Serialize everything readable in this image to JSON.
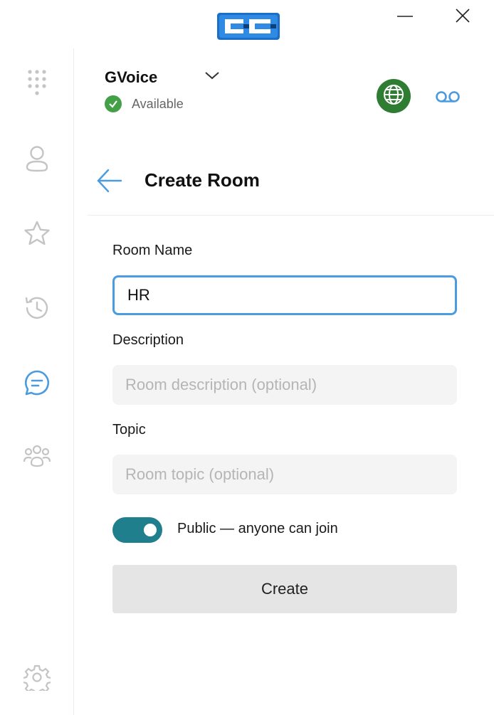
{
  "window": {
    "logo": "cc-logo",
    "minimize_icon": "minimize-icon",
    "close_icon": "close-icon"
  },
  "sidebar": {
    "items": [
      {
        "name": "dialpad",
        "icon": "dialpad-icon"
      },
      {
        "name": "contacts",
        "icon": "person-icon"
      },
      {
        "name": "favorites",
        "icon": "star-icon"
      },
      {
        "name": "history",
        "icon": "history-icon"
      },
      {
        "name": "chat",
        "icon": "chat-icon",
        "active": true
      },
      {
        "name": "groups",
        "icon": "group-icon"
      },
      {
        "name": "settings",
        "icon": "gear-icon"
      }
    ],
    "active_color": "#4a9be0",
    "inactive_color": "#c4c4c4"
  },
  "account": {
    "name": "GVoice",
    "status": "Available",
    "status_color": "#43a047"
  },
  "header_actions": {
    "globe_icon": "globe-icon",
    "globe_color": "#2e7d32",
    "voicemail_icon": "voicemail-icon"
  },
  "page": {
    "title": "Create Room",
    "back_icon": "back-arrow-icon"
  },
  "form": {
    "room_name_label": "Room Name",
    "room_name_value": "HR",
    "description_label": "Description",
    "description_placeholder": "Room description (optional)",
    "topic_label": "Topic",
    "topic_placeholder": "Room topic (optional)",
    "public_toggle_label": "Public — anyone can join",
    "public_toggle_on": true,
    "create_label": "Create"
  },
  "colors": {
    "accent": "#4a9be0",
    "toggle": "#1f7f8c",
    "button_bg": "#e5e5e5"
  }
}
